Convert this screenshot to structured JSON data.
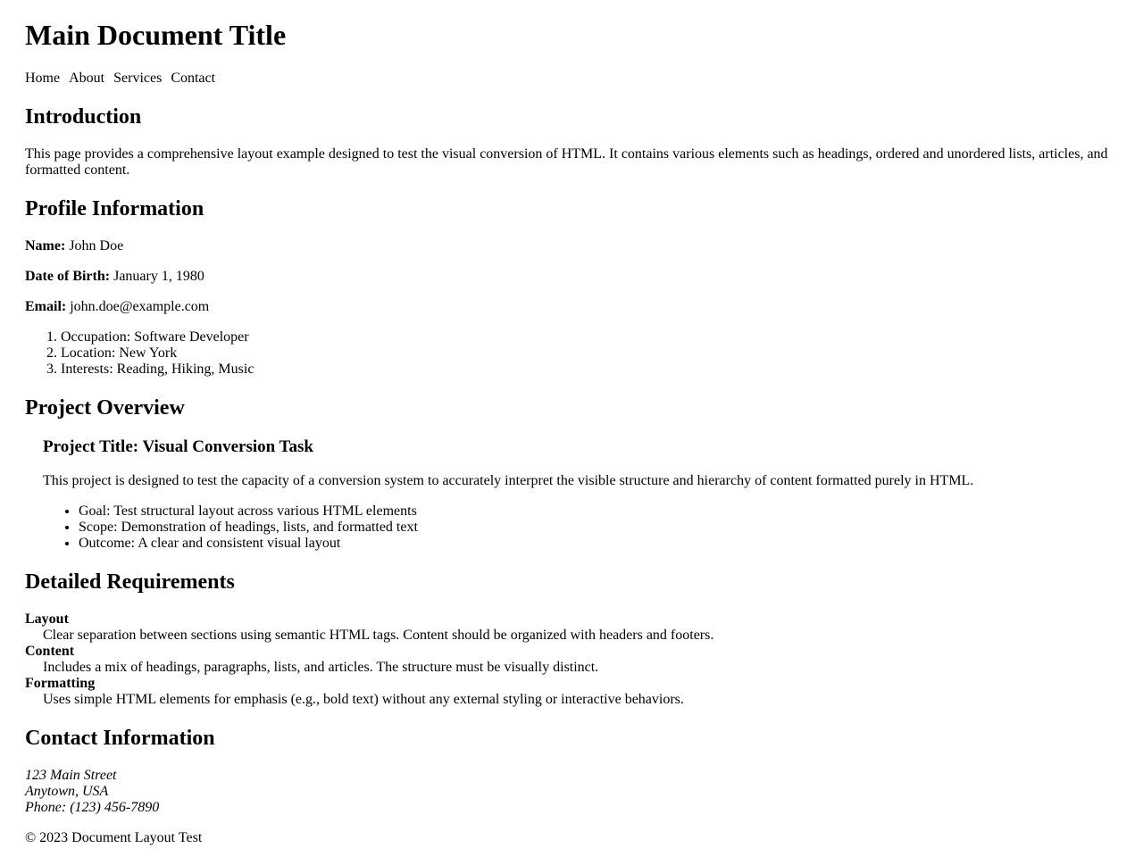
{
  "title": "Main Document Title",
  "nav": [
    "Home",
    "About",
    "Services",
    "Contact"
  ],
  "introduction": {
    "heading": "Introduction",
    "text": "This page provides a comprehensive layout example designed to test the visual conversion of HTML. It contains various elements such as headings, ordered and unordered lists, articles, and formatted content."
  },
  "profile": {
    "heading": "Profile Information",
    "name_label": "Name:",
    "name_value": "John Doe",
    "dob_label": "Date of Birth:",
    "dob_value": "January 1, 1980",
    "email_label": "Email:",
    "email_value": "john.doe@example.com",
    "details": [
      "Occupation: Software Developer",
      "Location: New York",
      "Interests: Reading, Hiking, Music"
    ]
  },
  "project": {
    "heading": "Project Overview",
    "subheading": "Project Title: Visual Conversion Task",
    "text": "This project is designed to test the capacity of a conversion system to accurately interpret the visible structure and hierarchy of content formatted purely in HTML.",
    "items": [
      "Goal: Test structural layout across various HTML elements",
      "Scope: Demonstration of headings, lists, and formatted text",
      "Outcome: A clear and consistent visual layout"
    ]
  },
  "requirements": {
    "heading": "Detailed Requirements",
    "items": [
      {
        "term": "Layout",
        "desc": "Clear separation between sections using semantic HTML tags. Content should be organized with headers and footers."
      },
      {
        "term": "Content",
        "desc": "Includes a mix of headings, paragraphs, lists, and articles. The structure must be visually distinct."
      },
      {
        "term": "Formatting",
        "desc": "Uses simple HTML elements for emphasis (e.g., bold text) without any external styling or interactive behaviors."
      }
    ]
  },
  "contact": {
    "heading": "Contact Information",
    "address": [
      "123 Main Street",
      "Anytown, USA",
      "Phone: (123) 456-7890"
    ]
  },
  "footer": "© 2023 Document Layout Test"
}
